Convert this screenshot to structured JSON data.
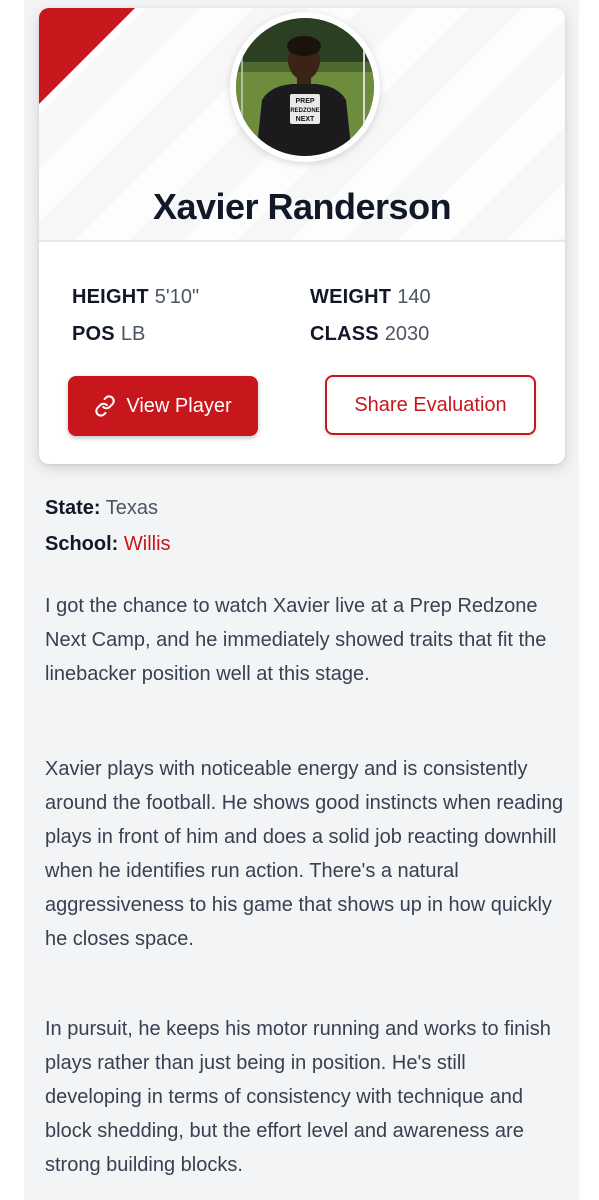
{
  "player": {
    "name": "Xavier Randerson",
    "photo": "player-headshot",
    "shirt_text": [
      "PREP",
      "REDZONE",
      "NEXT"
    ]
  },
  "stats": {
    "height_label": "HEIGHT",
    "height_value": "5'10\"",
    "weight_label": "WEIGHT",
    "weight_value": "140",
    "pos_label": "POS",
    "pos_value": "LB",
    "class_label": "CLASS",
    "class_value": "2030"
  },
  "buttons": {
    "view_player": "View Player",
    "view_player_icon": "link-icon",
    "share_evaluation": "Share Evaluation"
  },
  "details": {
    "state_label": "State:",
    "state_value": "Texas",
    "school_label": "School:",
    "school_value": "Willis"
  },
  "evaluation": {
    "paragraphs": [
      "I got the chance to watch Xavier live at a Prep Redzone Next Camp, and he immediately showed traits that fit the linebacker position well at this stage.",
      "Xavier plays with noticeable energy and is consistently around the football. He shows good instincts when reading plays in front of him and does a solid job reacting downhill when he identifies run action. There's a natural aggressiveness to his game that shows up in how quickly he closes space.",
      "In pursuit, he keeps his motor running and works to finish plays rather than just being in position. He's still developing in terms of consistency with technique and block shedding, but the effort level and awareness are strong building blocks."
    ]
  },
  "colors": {
    "accent": "#c8161d",
    "text_dark": "#111827",
    "text_muted": "#4b5563",
    "page_bg": "#f3f4f6"
  }
}
